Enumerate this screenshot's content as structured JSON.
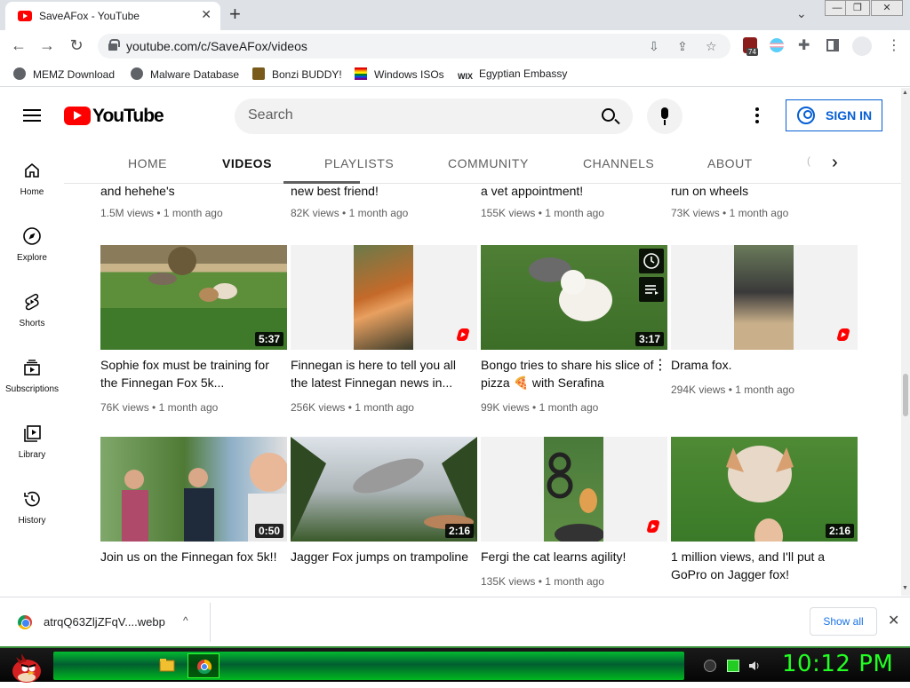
{
  "browser": {
    "tab_title": "SaveAFox - YouTube",
    "tab_close": "✕",
    "new_tab": "+",
    "url": "youtube.com/c/SaveAFox/videos",
    "extension_badge": "74"
  },
  "bookmarks": [
    {
      "label": "MEMZ Download",
      "icon": "globe-icon"
    },
    {
      "label": "Malware Database",
      "icon": "globe-icon"
    },
    {
      "label": "Bonzi BUDDY!",
      "icon": "bonzi-icon"
    },
    {
      "label": "Windows ISOs",
      "icon": "windows-flag-icon"
    },
    {
      "label": "Egyptian Embassy",
      "icon": "wix-icon"
    }
  ],
  "youtube": {
    "logo_text": "YouTube",
    "search_placeholder": "Search",
    "sign_in": "SIGN IN"
  },
  "guide": [
    {
      "label": "Home",
      "icon": "home-icon"
    },
    {
      "label": "Explore",
      "icon": "compass-icon"
    },
    {
      "label": "Shorts",
      "icon": "shorts-icon"
    },
    {
      "label": "Subscriptions",
      "icon": "subscriptions-icon"
    },
    {
      "label": "Library",
      "icon": "library-icon"
    },
    {
      "label": "History",
      "icon": "history-icon"
    }
  ],
  "channel_tabs": [
    "HOME",
    "VIDEOS",
    "PLAYLISTS",
    "COMMUNITY",
    "CHANNELS",
    "ABOUT"
  ],
  "active_tab": "VIDEOS",
  "videos": [
    {
      "title": "and hehehe's",
      "views": "1.5M views",
      "age": "1 month ago"
    },
    {
      "title": "new best friend!",
      "views": "82K views",
      "age": "1 month ago"
    },
    {
      "title": "a vet appointment!",
      "views": "155K views",
      "age": "1 month ago"
    },
    {
      "title": "run on wheels",
      "views": "73K views",
      "age": "1 month ago"
    },
    {
      "title": "Sophie fox must be training for the Finnegan Fox 5k...",
      "views": "76K views",
      "age": "1 month ago",
      "duration": "5:37"
    },
    {
      "title": "Finnegan is here to tell you all the latest Finnegan news in...",
      "views": "256K views",
      "age": "1 month ago",
      "duration": ""
    },
    {
      "title": "Bongo tries to share his slice of pizza 🍕 with Serafina",
      "views": "99K views",
      "age": "1 month ago",
      "duration": "3:17"
    },
    {
      "title": "Drama fox.",
      "views": "294K views",
      "age": "1 month ago",
      "duration": ""
    },
    {
      "title": "Join us on the Finnegan fox 5k!!",
      "views": "",
      "age": "",
      "duration": "0:50"
    },
    {
      "title": "Jagger Fox jumps on trampoline",
      "views": "",
      "age": "",
      "duration": "2:16"
    },
    {
      "title": "Fergi the cat learns agility!",
      "views": "135K views",
      "age": "1 month ago",
      "duration": ""
    },
    {
      "title": "1 million views, and I'll put a GoPro on Jagger fox!",
      "views": "",
      "age": "",
      "duration": "2:16"
    }
  ],
  "meta_separator": "•",
  "download": {
    "filename": "atrqQ63ZljZFqV....webp",
    "show_all": "Show all"
  },
  "taskbar": {
    "clock": "10:12 PM"
  }
}
